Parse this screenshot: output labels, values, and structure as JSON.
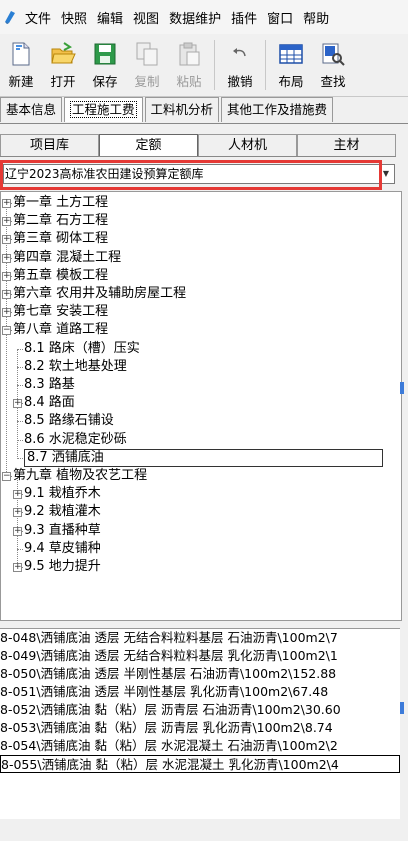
{
  "menu": {
    "items": [
      "文件",
      "快照",
      "编辑",
      "视图",
      "数据维护",
      "插件",
      "窗口",
      "帮助"
    ]
  },
  "toolbar": {
    "buttons": [
      {
        "label": "新建",
        "icon": "new-doc-icon",
        "enabled": true
      },
      {
        "label": "打开",
        "icon": "open-folder-icon",
        "enabled": true
      },
      {
        "label": "保存",
        "icon": "save-icon",
        "enabled": true
      },
      {
        "label": "复制",
        "icon": "copy-icon",
        "enabled": false
      },
      {
        "label": "粘贴",
        "icon": "paste-icon",
        "enabled": false
      },
      {
        "label": "撤销",
        "icon": "undo-icon",
        "enabled": true
      },
      {
        "label": "布局",
        "icon": "layout-grid-icon",
        "enabled": true
      },
      {
        "label": "查找",
        "icon": "find-icon",
        "enabled": true
      }
    ]
  },
  "outer_tabs": [
    "基本信息",
    "工程施工费",
    "工料机分析",
    "其他工作及措施费"
  ],
  "outer_active": 1,
  "inner_tabs": [
    "项目库",
    "定额",
    "人材机",
    "主材"
  ],
  "inner_active": 1,
  "quota_library": {
    "selected": "辽宁2023高标准农田建设预算定额库"
  },
  "tree": {
    "chapters": [
      "第一章 土方工程",
      "第二章 石方工程",
      "第三章 砌体工程",
      "第四章 混凝土工程",
      "第五章 模板工程",
      "第六章 农用井及辅助房屋工程",
      "第七章 安装工程",
      "第八章 道路工程"
    ],
    "ch8_items": [
      "8.1 路床（槽）压实",
      "8.2 软土地基处理",
      "8.3 路基",
      "8.4 路面",
      "8.5 路缘石铺设",
      "8.6 水泥稳定砂砾",
      "8.7 洒铺底油"
    ],
    "ch9": "第九章 植物及农艺工程",
    "ch9_items": [
      "9.1 栽植乔木",
      "9.2 栽植灌木",
      "9.3 直播种草",
      "9.4 草皮铺种",
      "9.5 地力提升"
    ]
  },
  "quota_list": [
    "8-048\\洒铺底油 透层 无结合料粒料基层 石油沥青\\100m2\\7",
    "8-049\\洒铺底油 透层 无结合料粒料基层 乳化沥青\\100m2\\1",
    "8-050\\洒铺底油 透层 半刚性基层 石油沥青\\100m2\\152.88",
    "8-051\\洒铺底油 透层 半刚性基层 乳化沥青\\100m2\\67.48",
    "8-052\\洒铺底油 黏（粘）层 沥青层 石油沥青\\100m2\\30.60",
    "8-053\\洒铺底油 黏（粘）层 沥青层 乳化沥青\\100m2\\8.74",
    "8-054\\洒铺底油 黏（粘）层 水泥混凝土 石油沥青\\100m2\\2",
    "8-055\\洒铺底油 黏（粘）层 水泥混凝土 乳化沥青\\100m2\\4"
  ],
  "colors": {
    "highlight_box": "#e53935",
    "scroll_marker": "#3d7bd9"
  }
}
